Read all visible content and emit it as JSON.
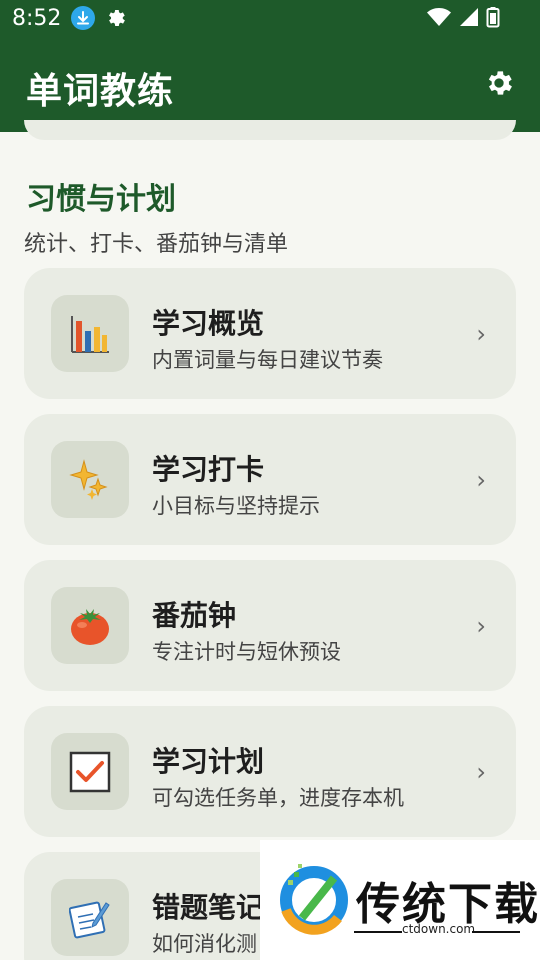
{
  "status_bar": {
    "time": "8:52"
  },
  "app_bar": {
    "title": "单词教练"
  },
  "section": {
    "title": "习惯与计划",
    "subtitle": "统计、打卡、番茄钟与清单"
  },
  "cards": [
    {
      "title": "学习概览",
      "desc": "内置词量与每日建议节奏",
      "icon": "bar-chart-icon"
    },
    {
      "title": "学习打卡",
      "desc": "小目标与坚持提示",
      "icon": "sparkles-icon"
    },
    {
      "title": "番茄钟",
      "desc": "专注计时与短休预设",
      "icon": "tomato-icon"
    },
    {
      "title": "学习计划",
      "desc": "可勾选任务单，进度存本机",
      "icon": "checkbox-icon"
    },
    {
      "title": "错题笔记",
      "desc": "如何消化测",
      "icon": "notebook-pen-icon"
    }
  ],
  "chevron": "›",
  "watermark": {
    "brand": "传统下载",
    "url": "ctdown.com"
  },
  "colors": {
    "accent": "#1e5a2a",
    "card_bg": "#e9ece4",
    "page_bg": "#f6f7f2"
  }
}
